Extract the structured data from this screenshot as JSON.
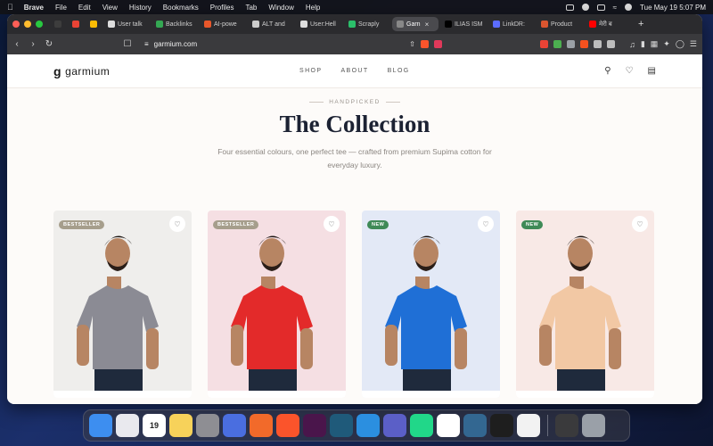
{
  "menubar": {
    "app": "Brave",
    "items": [
      "File",
      "Edit",
      "View",
      "History",
      "Bookmarks",
      "Profiles",
      "Tab",
      "Window",
      "Help"
    ],
    "clock": "Tue May 19  5:07 PM"
  },
  "tabs": [
    {
      "label": "",
      "color": "#3d3d3d"
    },
    {
      "label": "",
      "color": "#ea4335"
    },
    {
      "label": "",
      "color": "#fbbc04"
    },
    {
      "label": "User talk",
      "color": "#dddddd"
    },
    {
      "label": "Backlinks",
      "color": "#34a853"
    },
    {
      "label": "AI-powe",
      "color": "#e8572a"
    },
    {
      "label": "ALT and",
      "color": "#cccccc"
    },
    {
      "label": "User:Hell",
      "color": "#dddddd"
    },
    {
      "label": "Scraply",
      "color": "#2bbf6a"
    },
    {
      "label": "Garn",
      "color": "#888888",
      "active": true
    },
    {
      "label": "ILIAS ISM",
      "color": "#000000"
    },
    {
      "label": "LinkDR:",
      "color": "#5b6cff"
    },
    {
      "label": "Product",
      "color": "#da552f"
    },
    {
      "label": "मेरी ब",
      "color": "#ff0000"
    }
  ],
  "browser": {
    "url": "garmium.com"
  },
  "site": {
    "brand": "garmium",
    "brand_mark": "g",
    "nav": [
      "SHOP",
      "ABOUT",
      "BLOG"
    ],
    "eyebrow": "HANDPICKED",
    "title": "The Collection",
    "subtitle": "Four essential colours, one perfect tee — crafted from premium Supima cotton for everyday luxury.",
    "products": [
      {
        "badge": "BESTSELLER",
        "badge_color": "#a69e8c",
        "card_bg": "#efeeec",
        "tee_color": "#8b8b94"
      },
      {
        "badge": "BESTSELLER",
        "badge_color": "#a69e8c",
        "card_bg": "#f5dfe3",
        "tee_color": "#e32a2a"
      },
      {
        "badge": "NEW",
        "badge_color": "#3f8a57",
        "card_bg": "#e3e9f6",
        "tee_color": "#1f6fd6"
      },
      {
        "badge": "NEW",
        "badge_color": "#3f8a57",
        "card_bg": "#f8e9e6",
        "tee_color": "#f2c8a4"
      }
    ]
  },
  "dock": [
    {
      "name": "finder",
      "color": "#3d8ef0"
    },
    {
      "name": "launchpad",
      "color": "#e9e9ee"
    },
    {
      "name": "calendar",
      "color": "#ffffff",
      "label": "19"
    },
    {
      "name": "notes",
      "color": "#f7d25a"
    },
    {
      "name": "settings",
      "color": "#8e8e93"
    },
    {
      "name": "app-blue",
      "color": "#4a6ee0"
    },
    {
      "name": "app-orange",
      "color": "#f26a2a"
    },
    {
      "name": "brave",
      "color": "#fb542b"
    },
    {
      "name": "slack",
      "color": "#4a154b"
    },
    {
      "name": "app-teal",
      "color": "#1f5a7a"
    },
    {
      "name": "vscode",
      "color": "#2b8fe0"
    },
    {
      "name": "teams",
      "color": "#5b5fc7"
    },
    {
      "name": "pycharm",
      "color": "#21d789"
    },
    {
      "name": "chrome",
      "color": "#ffffff"
    },
    {
      "name": "postgres",
      "color": "#336791"
    },
    {
      "name": "terminal",
      "color": "#1e1e1e"
    },
    {
      "name": "app-white",
      "color": "#f2f2f2"
    },
    {
      "name": "calculator",
      "color": "#3a3a3c"
    },
    {
      "name": "trash",
      "color": "#9aa0a8"
    }
  ]
}
